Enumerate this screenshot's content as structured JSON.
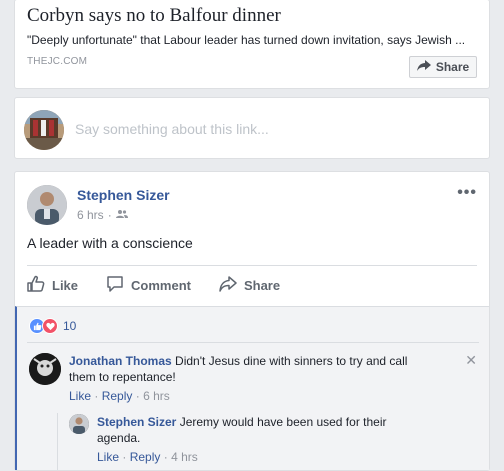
{
  "link_preview": {
    "title": "Corbyn says no to Balfour dinner",
    "description": "\"Deeply unfortunate\" that Labour leader has turned down invitation, says Jewish ...",
    "domain": "THEJC.COM",
    "share_label": "Share"
  },
  "composer": {
    "placeholder": "Say something about this link..."
  },
  "post": {
    "author": "Stephen Sizer",
    "time": "6 hrs",
    "privacy_icon": "friends-icon",
    "text": "A leader with a conscience",
    "more": "•••",
    "actions": {
      "like": "Like",
      "comment": "Comment",
      "share": "Share"
    },
    "reactions": {
      "count": "10",
      "types": [
        "like",
        "love"
      ]
    }
  },
  "comments": [
    {
      "author": "Jonathan Thomas",
      "text_line1": "Didn't Jesus dine with sinners to try and call",
      "text_line2": "them to repentance!",
      "like": "Like",
      "reply": "Reply",
      "time": "6 hrs",
      "close": "✕",
      "replies": [
        {
          "author": "Stephen Sizer",
          "text_line1": "Jeremy would have been used for their",
          "text_line2": "agenda.",
          "like": "Like",
          "reply": "Reply",
          "time": "4 hrs"
        }
      ]
    }
  ],
  "colors": {
    "link_blue": "#365899",
    "accent": "#4267b2",
    "muted": "#90949c",
    "background": "#e9ebee"
  }
}
